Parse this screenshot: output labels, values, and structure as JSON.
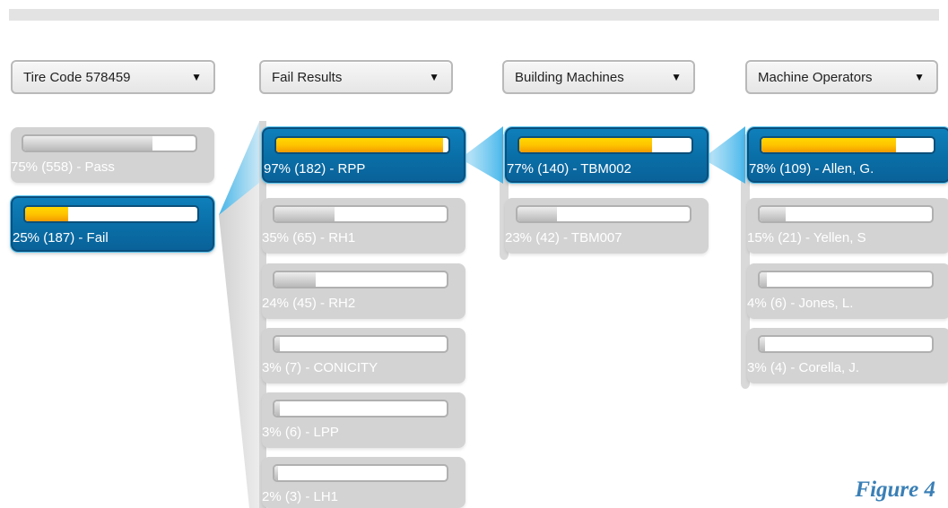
{
  "dropdowns": [
    {
      "label": "Tire Code 578459"
    },
    {
      "label": "Fail Results"
    },
    {
      "label": "Building Machines"
    },
    {
      "label": "Machine Operators"
    }
  ],
  "columns": [
    {
      "name": "tire-code",
      "items": [
        {
          "caption": "75% (558) - Pass",
          "percent": 75,
          "active": false
        },
        {
          "caption": "25% (187) - Fail",
          "percent": 25,
          "active": true
        }
      ]
    },
    {
      "name": "fail-results",
      "items": [
        {
          "caption": "97% (182) - RPP",
          "percent": 97,
          "active": true
        },
        {
          "caption": "35% (65) - RH1",
          "percent": 35,
          "active": false
        },
        {
          "caption": "24% (45) - RH2",
          "percent": 24,
          "active": false
        },
        {
          "caption": "3% (7) - CONICITY",
          "percent": 3,
          "active": false
        },
        {
          "caption": "3% (6) - LPP",
          "percent": 3,
          "active": false
        },
        {
          "caption": "2% (3) - LH1",
          "percent": 2,
          "active": false
        }
      ]
    },
    {
      "name": "building-machines",
      "items": [
        {
          "caption": "77% (140) - TBM002",
          "percent": 77,
          "active": true
        },
        {
          "caption": "23% (42) - TBM007",
          "percent": 23,
          "active": false
        }
      ]
    },
    {
      "name": "machine-operators",
      "items": [
        {
          "caption": "78% (109) - Allen, G.",
          "percent": 78,
          "active": true
        },
        {
          "caption": "15% (21) - Yellen, S",
          "percent": 15,
          "active": false
        },
        {
          "caption": "4% (6) - Jones, L.",
          "percent": 4,
          "active": false
        },
        {
          "caption": "3% (4) - Corella, J.",
          "percent": 3,
          "active": false
        }
      ]
    }
  ],
  "figure_caption": "Figure 4",
  "colors": {
    "active_blue": "#0a6ea6",
    "highlight_yellow": "#ffc400",
    "inactive_gray": "#d3d3d3",
    "caption_blue": "#3a7fb6"
  }
}
